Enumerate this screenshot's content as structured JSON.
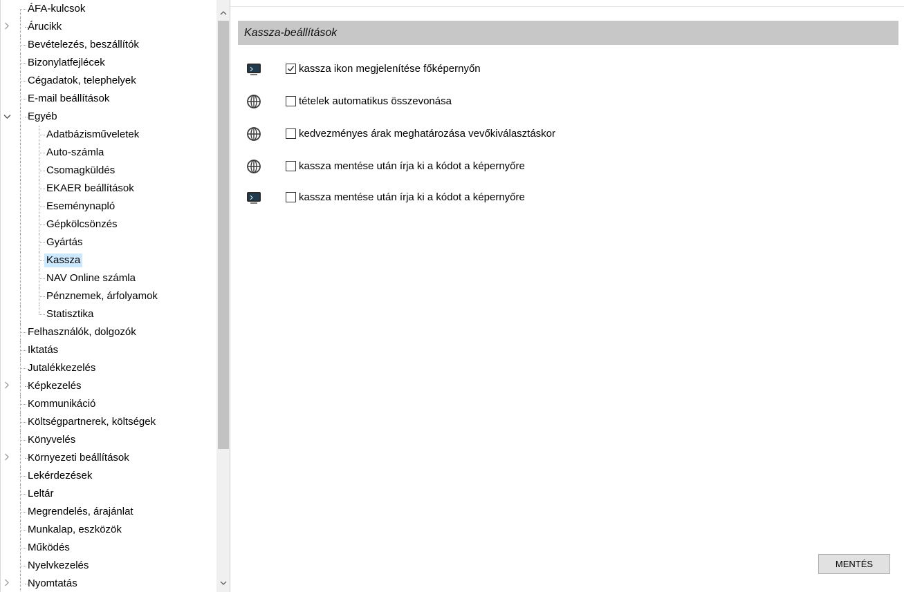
{
  "tree": {
    "items": [
      {
        "label": "ÁFA-kulcsok",
        "level": 0,
        "expander": "none"
      },
      {
        "label": "Árucikk",
        "level": 0,
        "expander": "collapsed"
      },
      {
        "label": "Bevételezés, beszállítók",
        "level": 0,
        "expander": "none"
      },
      {
        "label": "Bizonylatfejlécek",
        "level": 0,
        "expander": "none"
      },
      {
        "label": "Cégadatok, telephelyek",
        "level": 0,
        "expander": "none"
      },
      {
        "label": "E-mail beállítások",
        "level": 0,
        "expander": "none"
      },
      {
        "label": "Egyéb",
        "level": 0,
        "expander": "expanded"
      },
      {
        "label": "Adatbázisműveletek",
        "level": 1,
        "expander": "none"
      },
      {
        "label": "Auto-számla",
        "level": 1,
        "expander": "none"
      },
      {
        "label": "Csomagküldés",
        "level": 1,
        "expander": "none"
      },
      {
        "label": "EKAER beállítások",
        "level": 1,
        "expander": "none"
      },
      {
        "label": "Eseménynapló",
        "level": 1,
        "expander": "none"
      },
      {
        "label": "Gépkölcsönzés",
        "level": 1,
        "expander": "none"
      },
      {
        "label": "Gyártás",
        "level": 1,
        "expander": "none"
      },
      {
        "label": "Kassza",
        "level": 1,
        "expander": "none",
        "selected": true
      },
      {
        "label": "NAV Online számla",
        "level": 1,
        "expander": "none"
      },
      {
        "label": "Pénznemek, árfolyamok",
        "level": 1,
        "expander": "none"
      },
      {
        "label": "Statisztika",
        "level": 1,
        "expander": "none",
        "last_child": true
      },
      {
        "label": "Felhasználók, dolgozók",
        "level": 0,
        "expander": "none"
      },
      {
        "label": "Iktatás",
        "level": 0,
        "expander": "none"
      },
      {
        "label": "Jutalékkezelés",
        "level": 0,
        "expander": "none"
      },
      {
        "label": "Képkezelés",
        "level": 0,
        "expander": "collapsed"
      },
      {
        "label": "Kommunikáció",
        "level": 0,
        "expander": "none"
      },
      {
        "label": "Költségpartnerek, költségek",
        "level": 0,
        "expander": "none"
      },
      {
        "label": "Könyvelés",
        "level": 0,
        "expander": "none"
      },
      {
        "label": "Környezeti beállítások",
        "level": 0,
        "expander": "collapsed"
      },
      {
        "label": "Lekérdezések",
        "level": 0,
        "expander": "none"
      },
      {
        "label": "Leltár",
        "level": 0,
        "expander": "none"
      },
      {
        "label": "Megrendelés, árajánlat",
        "level": 0,
        "expander": "none"
      },
      {
        "label": "Munkalap, eszközök",
        "level": 0,
        "expander": "none"
      },
      {
        "label": "Működés",
        "level": 0,
        "expander": "none"
      },
      {
        "label": "Nyelvkezelés",
        "level": 0,
        "expander": "none"
      },
      {
        "label": "Nyomtatás",
        "level": 0,
        "expander": "collapsed"
      }
    ]
  },
  "settings": {
    "title": "Kassza-beállítások",
    "options": [
      {
        "icon": "monitor-icon",
        "checked": true,
        "label": "kassza ikon megjelenítése főképernyőn"
      },
      {
        "icon": "globe-icon",
        "checked": false,
        "label": "tételek automatikus összevonása"
      },
      {
        "icon": "globe-icon",
        "checked": false,
        "label": "kedvezményes árak meghatározása vevőkiválasztáskor"
      },
      {
        "icon": "globe-icon",
        "checked": false,
        "label": "kassza mentése után írja ki a kódot a képernyőre"
      },
      {
        "icon": "monitor-icon",
        "checked": false,
        "label": "kassza mentése után írja ki a kódot a képernyőre"
      }
    ],
    "save_label": "MENTÉS"
  },
  "scrollbar": {
    "up_glyph": "^",
    "down_glyph": "v"
  }
}
